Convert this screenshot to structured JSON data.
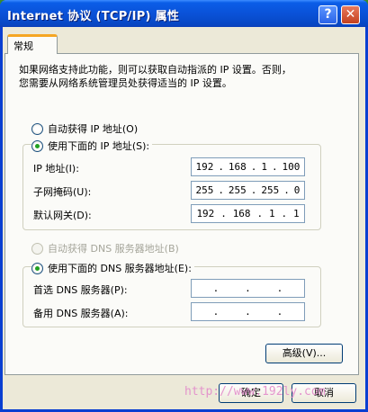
{
  "window": {
    "title": "Internet 协议 (TCP/IP) 属性",
    "help_label": "?",
    "close_label": "✕"
  },
  "tabs": [
    {
      "label": "常规"
    }
  ],
  "description": {
    "line1": "如果网络支持此功能，则可以获取自动指派的 IP 设置。否则，",
    "line2": "您需要从网络系统管理员处获得适当的 IP 设置。"
  },
  "ip": {
    "auto_label": "自动获得 IP 地址(O)",
    "manual_label": "使用下面的 IP 地址(S):",
    "selected": "manual",
    "fields": [
      {
        "label": "IP 地址(I):",
        "octets": [
          "192",
          "168",
          "1",
          "100"
        ]
      },
      {
        "label": "子网掩码(U):",
        "octets": [
          "255",
          "255",
          "255",
          "0"
        ]
      },
      {
        "label": "默认网关(D):",
        "octets": [
          "192",
          "168",
          "1",
          "1"
        ]
      }
    ]
  },
  "dns": {
    "auto_label": "自动获得 DNS 服务器地址(B)",
    "manual_label": "使用下面的 DNS 服务器地址(E):",
    "selected": "manual",
    "fields": [
      {
        "label": "首选 DNS 服务器(P):",
        "octets": [
          "",
          "",
          "",
          ""
        ]
      },
      {
        "label": "备用 DNS 服务器(A):",
        "octets": [
          "",
          "",
          "",
          ""
        ]
      }
    ]
  },
  "buttons": {
    "advanced": "高级(V)...",
    "ok": "确定",
    "cancel": "取消"
  },
  "watermark": "http://www.192ly.com"
}
